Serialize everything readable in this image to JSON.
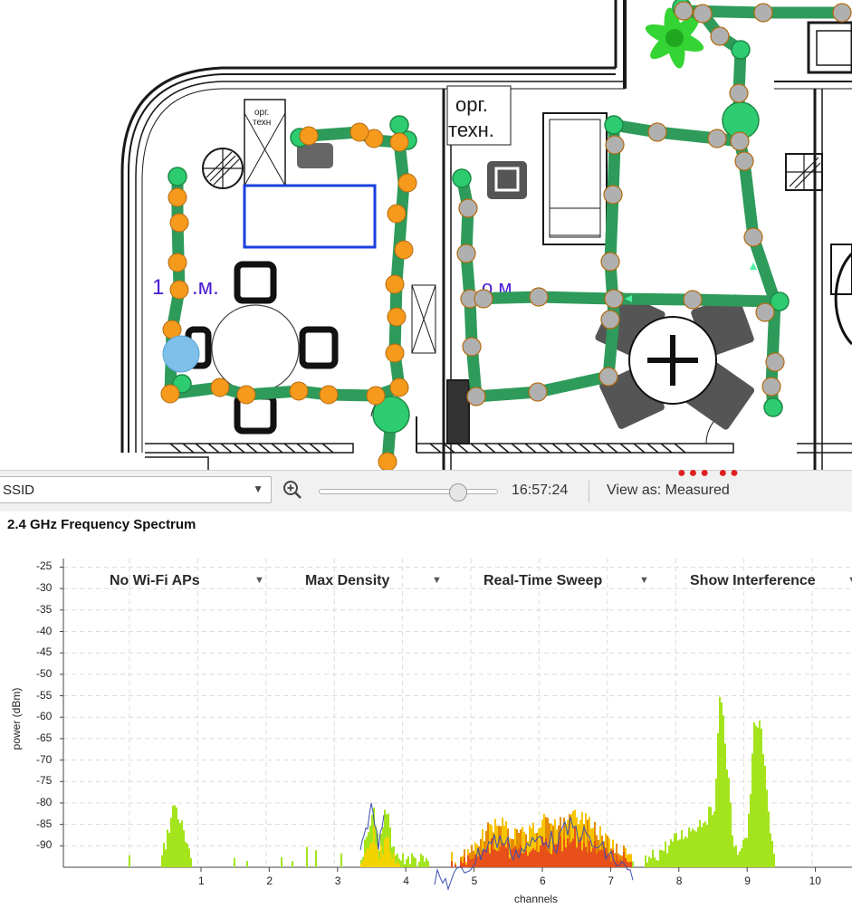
{
  "floorplan": {
    "room_label_1": "орг.",
    "room_label_1b": "техн",
    "room_label_2": "орг.",
    "room_label_2b": "техн.",
    "room_mark_left": "1",
    "room_mark_left_b": ".м.",
    "room_mark_right": "о.м.",
    "colors": {
      "path": "#2e9b5a",
      "orange": "#f59a1c",
      "gray": "#b0b0b0",
      "blue_marker": "#7ec0ea",
      "wall": "#1a1a1a"
    }
  },
  "toolbar": {
    "ssid_value": "SSID",
    "time": "16:57:24",
    "view_as": "View as: Measured",
    "slider_value": 0.78
  },
  "spectrum": {
    "title": "2.4 GHz Frequency Spectrum",
    "dropdowns": [
      {
        "label": "No Wi-Fi APs"
      },
      {
        "label": "Max Density"
      },
      {
        "label": "Real-Time Sweep"
      },
      {
        "label": "Show Interference"
      }
    ],
    "y_axis_label": "power (dBm)",
    "x_axis_label": "channels",
    "y_ticks": [
      "-25",
      "-30",
      "-35",
      "-40",
      "-45",
      "-50",
      "-55",
      "-60",
      "-65",
      "-70",
      "-75",
      "-80",
      "-85",
      "-90"
    ],
    "x_ticks": [
      "1",
      "2",
      "3",
      "4",
      "5",
      "6",
      "7",
      "8",
      "9",
      "10"
    ]
  },
  "chart_data": {
    "type": "area",
    "xlabel": "channels",
    "ylabel": "power (dBm)",
    "ylim": [
      -95,
      -23
    ],
    "xlim": [
      -1,
      10.5
    ],
    "grid": true,
    "series": [
      {
        "x": [
          0.4,
          0.5,
          0.6,
          0.7,
          0.8,
          0.9,
          1.3,
          2.1,
          3.3,
          3.4,
          3.5,
          3.6,
          3.7,
          3.8,
          4.6,
          4.8,
          5.0,
          5.2,
          5.4,
          5.6,
          5.8,
          6.0,
          6.2,
          6.4,
          6.6,
          6.8,
          7.0,
          7.2,
          7.4,
          8.5,
          8.6,
          8.7,
          8.8,
          9.0,
          9.1,
          9.2,
          9.3,
          9.4
        ],
        "y": [
          -92,
          -85,
          -78,
          -83,
          -90,
          -93,
          -94,
          -94,
          -93,
          -86,
          -79,
          -88,
          -78,
          -90,
          -93,
          -91,
          -88,
          -84,
          -83,
          -86,
          -85,
          -82,
          -84,
          -80,
          -82,
          -85,
          -87,
          -90,
          -93,
          -80,
          -51,
          -70,
          -90,
          -85,
          -58,
          -62,
          -80,
          -92
        ]
      }
    ]
  }
}
